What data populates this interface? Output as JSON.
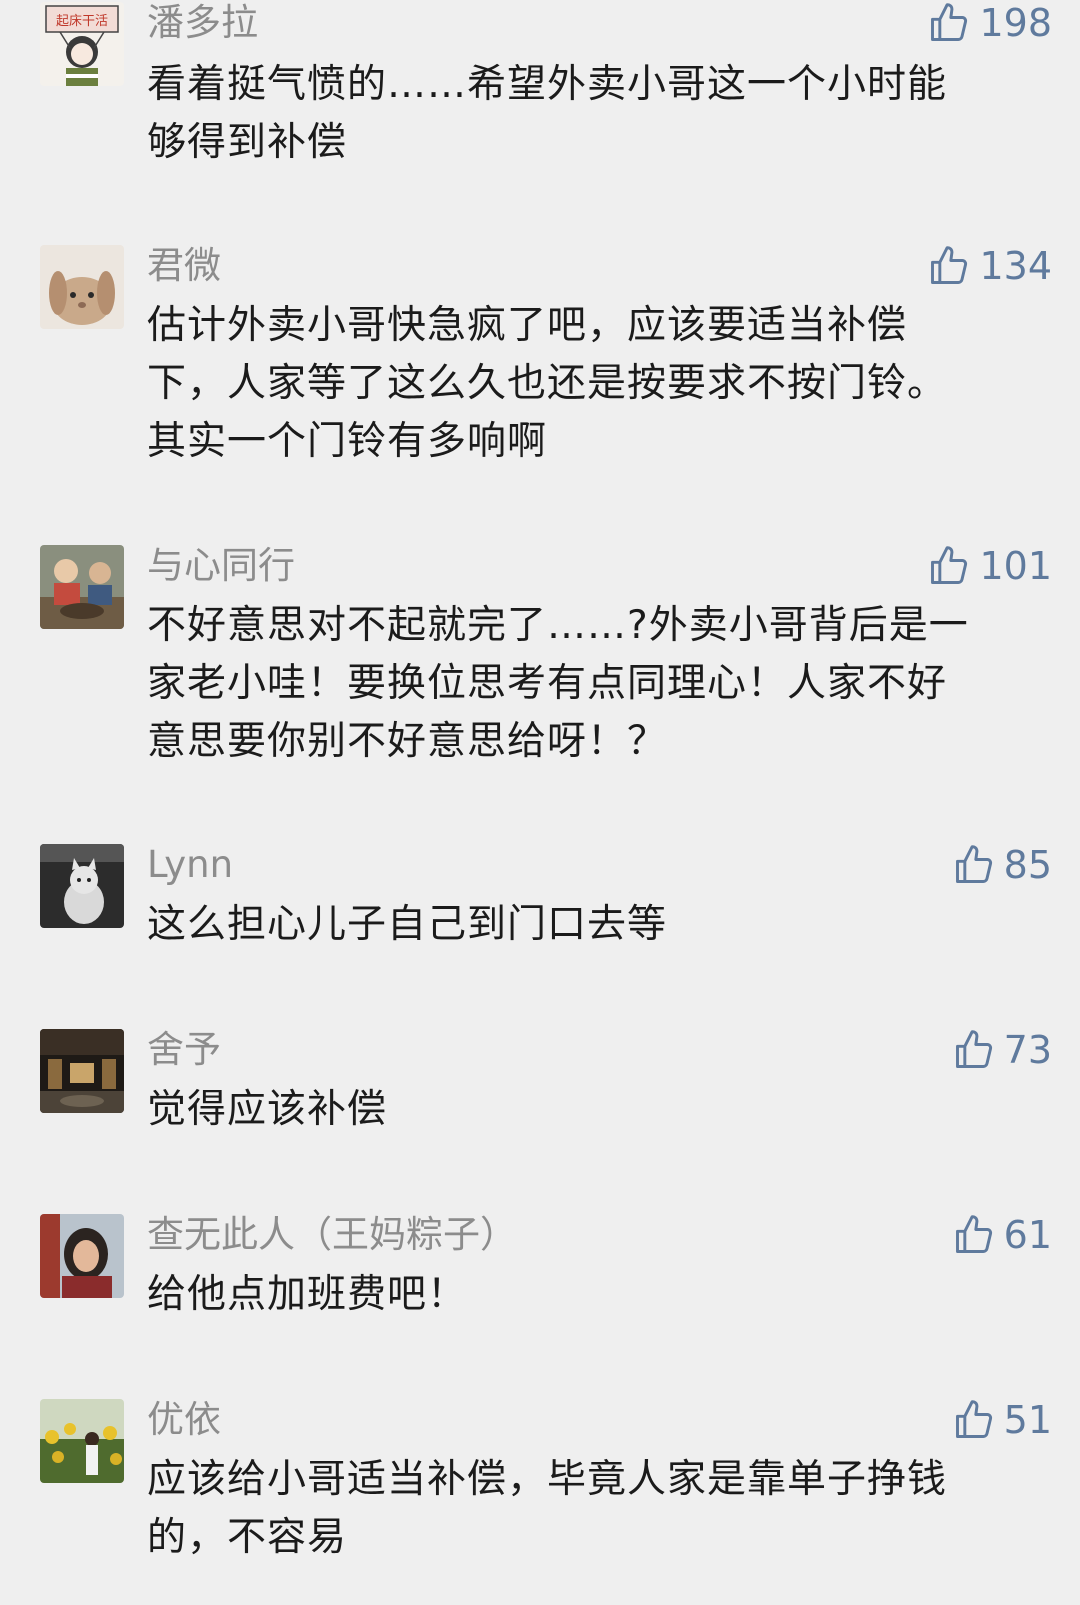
{
  "comments": [
    {
      "avatar_icon": "avatar-girl-sign-icon",
      "avatar_label": "起床干活",
      "name": "潘多拉",
      "likes": "198",
      "text_lines": [
        "看着挺气愤的……希望外卖小哥这一个小时能",
        "够得到补偿"
      ]
    },
    {
      "avatar_icon": "avatar-rabbit-icon",
      "name": "君微",
      "likes": "134",
      "text_lines": [
        "估计外卖小哥快急疯了吧，应该要适当补偿",
        "下，人家等了这么久也还是按要求不按门铃。",
        "其实一个门铃有多响啊"
      ]
    },
    {
      "avatar_icon": "avatar-children-photo-icon",
      "name": "与心同行",
      "likes": "101",
      "text_lines": [
        "不好意思对不起就完了……?外卖小哥背后是一",
        "家老小哇！要换位思考有点同理心！人家不好",
        "意思要你别不好意思给呀！？"
      ]
    },
    {
      "avatar_icon": "avatar-cat-photo-icon",
      "name": "Lynn",
      "likes": "85",
      "text_lines": [
        "这么担心儿子自己到门口去等"
      ]
    },
    {
      "avatar_icon": "avatar-hall-photo-icon",
      "name": "舍予",
      "likes": "73",
      "text_lines": [
        "觉得应该补偿"
      ]
    },
    {
      "avatar_icon": "avatar-woman-photo-icon",
      "name": "查无此人（王妈粽子）",
      "likes": "61",
      "text_lines": [
        "给他点加班费吧！"
      ]
    },
    {
      "avatar_icon": "avatar-sunflower-photo-icon",
      "name": "优依",
      "likes": "51",
      "text_lines": [
        "应该给小哥适当补偿，毕竟人家是靠单子挣钱",
        "的，不容易"
      ]
    }
  ]
}
